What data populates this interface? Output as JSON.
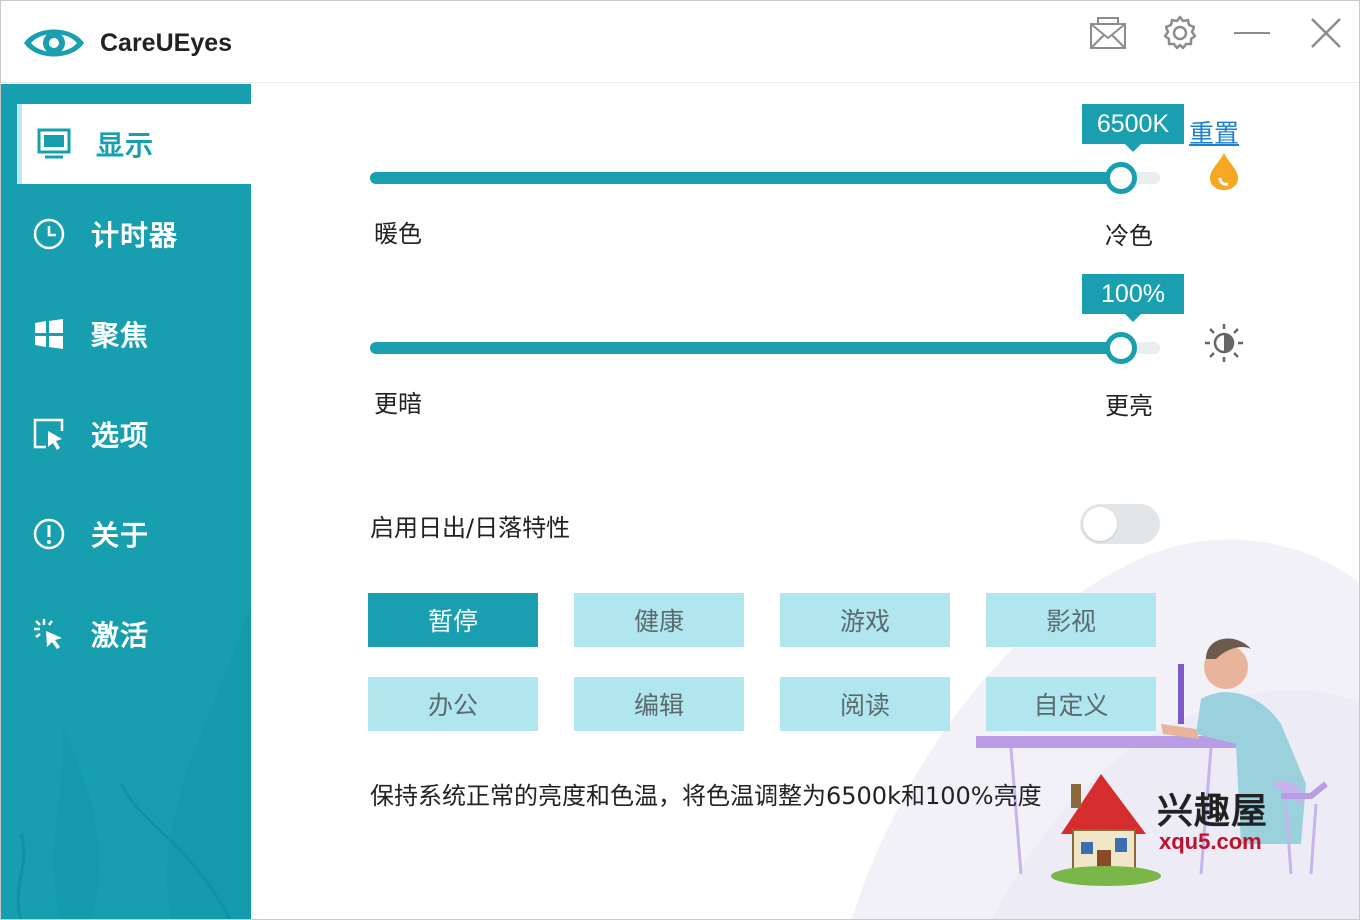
{
  "app": {
    "title": "CareUEyes"
  },
  "titlebar": {
    "icons": [
      "mail-icon",
      "gear-icon",
      "minimize-icon",
      "close-icon"
    ]
  },
  "sidebar": {
    "items": [
      {
        "label": "显示",
        "icon": "monitor-icon",
        "active": true
      },
      {
        "label": "计时器",
        "icon": "clock-icon",
        "active": false
      },
      {
        "label": "聚焦",
        "icon": "windows-icon",
        "active": false
      },
      {
        "label": "选项",
        "icon": "cursor-select-icon",
        "active": false
      },
      {
        "label": "关于",
        "icon": "info-icon",
        "active": false
      },
      {
        "label": "激活",
        "icon": "click-sparkle-icon",
        "active": false
      }
    ]
  },
  "color_temp": {
    "value_label": "6500K",
    "value": 6500,
    "level": 0.95,
    "min_label": "暖色",
    "max_label": "冷色",
    "reset_label": "重置",
    "icon": "droplet-icon"
  },
  "brightness": {
    "value_label": "100%",
    "value": 100,
    "level": 0.95,
    "min_label": "更暗",
    "max_label": "更亮",
    "icon": "brightness-icon"
  },
  "sunrise": {
    "label": "启用日出/日落特性",
    "enabled": false
  },
  "modes": [
    {
      "label": "暂停",
      "selected": true
    },
    {
      "label": "健康",
      "selected": false
    },
    {
      "label": "游戏",
      "selected": false
    },
    {
      "label": "影视",
      "selected": false
    },
    {
      "label": "办公",
      "selected": false
    },
    {
      "label": "编辑",
      "selected": false
    },
    {
      "label": "阅读",
      "selected": false
    },
    {
      "label": "自定义",
      "selected": false
    }
  ],
  "description": "保持系统正常的亮度和色温，将色温调整为6500k和100%亮度",
  "watermark": {
    "title": "兴趣屋",
    "url": "xqu5.com"
  },
  "colors": {
    "accent": "#1a9fb0",
    "sidebar": "#179fb0",
    "mode_button": "#b2e6ee",
    "link": "#1d7fd1"
  }
}
